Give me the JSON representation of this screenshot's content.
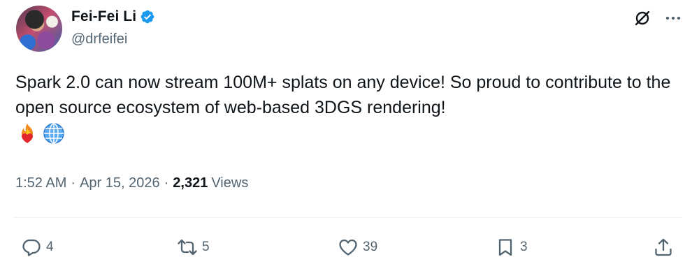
{
  "author": {
    "name": "Fei-Fei Li",
    "handle": "@drfeifei",
    "verified": true,
    "avatar_icon": "profile-photo"
  },
  "tweet": {
    "text": "Spark 2.0 can now stream 100M+ splats on any device! So proud to contribute to the open source ecosystem of web-based 3DGS rendering!",
    "emojis": [
      "fire-heart-emoji",
      "globe-emoji"
    ]
  },
  "meta": {
    "time": "1:52 AM",
    "separator": "·",
    "date": "Apr 15, 2026",
    "views_count": "2,321",
    "views_label": "Views"
  },
  "actions": {
    "replies": "4",
    "reposts": "5",
    "likes": "39",
    "bookmarks": "3"
  },
  "colors": {
    "text": "#0f1419",
    "secondary": "#536471",
    "verified_blue": "#1d9bf0",
    "divider": "#eff3f4"
  }
}
